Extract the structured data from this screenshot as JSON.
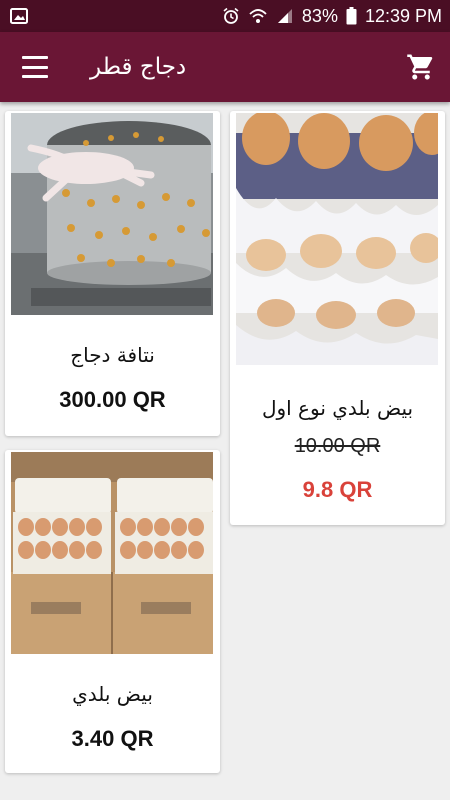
{
  "status": {
    "battery": "83%",
    "time": "12:39 PM"
  },
  "app": {
    "title": "دجاج قطر",
    "menu_icon": "hamburger-menu-icon",
    "cart_icon": "shopping-cart-icon"
  },
  "colors": {
    "status_bar": "#4a0e24",
    "app_bar": "#6a1635",
    "sale_price": "#d9423a"
  },
  "products": [
    {
      "name": "نتافة دجاج",
      "price": "300.00 QR",
      "image": "chicken-plucker-machine"
    },
    {
      "name": "بيض بلدي نوع اول",
      "old_price": "10.00 QR",
      "price": "9.8 QR",
      "image": "egg-trays"
    },
    {
      "name": "بيض بلدي",
      "price": "3.40 QR",
      "image": "boxed-egg-cartons"
    }
  ]
}
